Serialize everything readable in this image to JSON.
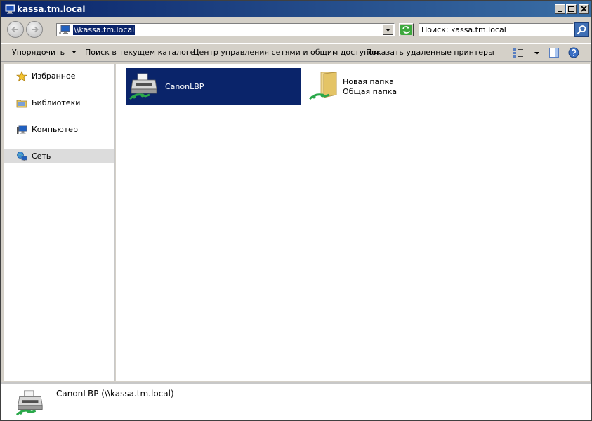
{
  "window": {
    "title": "kassa.tm.local",
    "icon": "computer-icon"
  },
  "address": {
    "path": "\\\\kassa.tm.local",
    "icon": "computer-icon"
  },
  "search": {
    "value": "Поиск: kassa.tm.local"
  },
  "toolbar": {
    "organize": "Упорядочить",
    "search_in_folder": "Поиск в текущем каталоге",
    "network_center": "Центр управления сетями и общим доступом",
    "show_remote_printers": "Показать удаленные принтеры"
  },
  "nav": {
    "items": [
      {
        "label": "Избранное",
        "icon": "star-icon"
      },
      {
        "label": "Библиотеки",
        "icon": "library-icon"
      },
      {
        "label": "Компьютер",
        "icon": "computer-icon"
      },
      {
        "label": "Сеть",
        "icon": "network-icon"
      }
    ],
    "selected": "Сеть"
  },
  "items": [
    {
      "name": "CanonLBP",
      "subtitle": "",
      "icon": "network-printer-icon",
      "selected": true
    },
    {
      "name": "Новая папка",
      "subtitle": "Общая папка",
      "icon": "shared-folder-icon",
      "selected": false
    }
  ],
  "details": {
    "text": "CanonLBP (\\\\kassa.tm.local)",
    "icon": "network-printer-icon"
  },
  "colors": {
    "selection": "#0a246a",
    "title_gradient_start": "#0a246a",
    "title_gradient_end": "#3a6ea5"
  }
}
